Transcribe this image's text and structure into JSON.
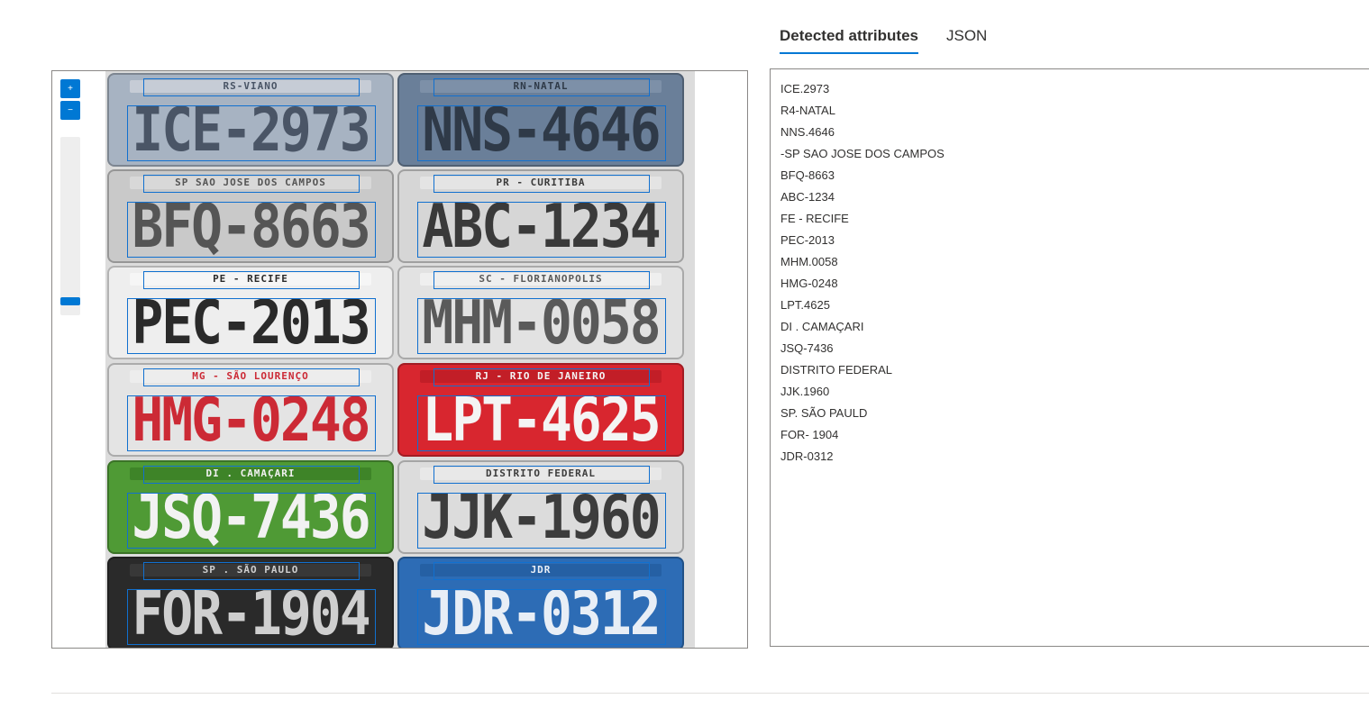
{
  "tabs": {
    "detected": "Detected attributes",
    "json": "JSON"
  },
  "viewer": {
    "zoom_in": "+",
    "zoom_out": "−"
  },
  "plates": [
    {
      "strip": "RS-VIANO",
      "number": "ICE-2973",
      "bg": "#a7b3c2",
      "fg": "#4a5566",
      "strip_bg": "#c6ccd6"
    },
    {
      "strip": "RN-NATAL",
      "number": "NNS-4646",
      "bg": "#6a7f99",
      "fg": "#2f3a48",
      "strip_bg": "#7d90a8"
    },
    {
      "strip": "SP SAO JOSE DOS CAMPOS",
      "number": "BFQ-8663",
      "bg": "#c9c9c9",
      "fg": "#555555",
      "strip_bg": "#d8d8d8"
    },
    {
      "strip": "PR - CURITIBA",
      "number": "ABC-1234",
      "bg": "#d6d6d6",
      "fg": "#3a3a3a",
      "strip_bg": "#e4e4e4"
    },
    {
      "strip": "PE - RECIFE",
      "number": "PEC-2013",
      "bg": "#eeeeee",
      "fg": "#2a2a2a",
      "strip_bg": "#f6f6f6"
    },
    {
      "strip": "SC - FLORIANOPOLIS",
      "number": "MHM-0058",
      "bg": "#e2e2e2",
      "fg": "#5a5a5a",
      "strip_bg": "#efefef"
    },
    {
      "strip": "MG - SÃO LOURENÇO",
      "number": "HMG-0248",
      "bg": "#e4e4e4",
      "fg": "#cc2a35",
      "strip_bg": "#ededed"
    },
    {
      "strip": "RJ - RIO DE JANEIRO",
      "number": "LPT-4625",
      "bg": "#d8262f",
      "fg": "#f4f4f4",
      "strip_bg": "#c21e27"
    },
    {
      "strip": "DI . CAMAÇARI",
      "number": "JSQ-7436",
      "bg": "#4f9a35",
      "fg": "#f2f2f2",
      "strip_bg": "#3e8428"
    },
    {
      "strip": "DISTRITO FEDERAL",
      "number": "JJK-1960",
      "bg": "#dcdcdc",
      "fg": "#3c3c3c",
      "strip_bg": "#e8e8e8"
    },
    {
      "strip": "SP . SÃO PAULO",
      "number": "FOR-1904",
      "bg": "#2a2a2a",
      "fg": "#cfcfcf",
      "strip_bg": "#383838"
    },
    {
      "strip": "JDR",
      "number": "JDR-0312",
      "bg": "#2d6cb5",
      "fg": "#e8eef6",
      "strip_bg": "#2560a4"
    }
  ],
  "attributes": [
    "ICE.2973",
    "R4-NATAL",
    "NNS.4646",
    "-SP SAO JOSE DOS CAMPOS",
    "BFQ-8663",
    "ABC-1234",
    "FE - RECIFE",
    "PEC-2013",
    "MHM.0058",
    "HMG-0248",
    "LPT.4625",
    "DI . CAMAÇARI",
    "JSQ-7436",
    "DISTRITO FEDERAL",
    "JJK.1960",
    "SP. SÃO PAULD",
    "FOR- 1904",
    "JDR-0312"
  ],
  "colors": {
    "accent": "#0078d4",
    "box": "#1170cf",
    "border": "#8a8886"
  }
}
